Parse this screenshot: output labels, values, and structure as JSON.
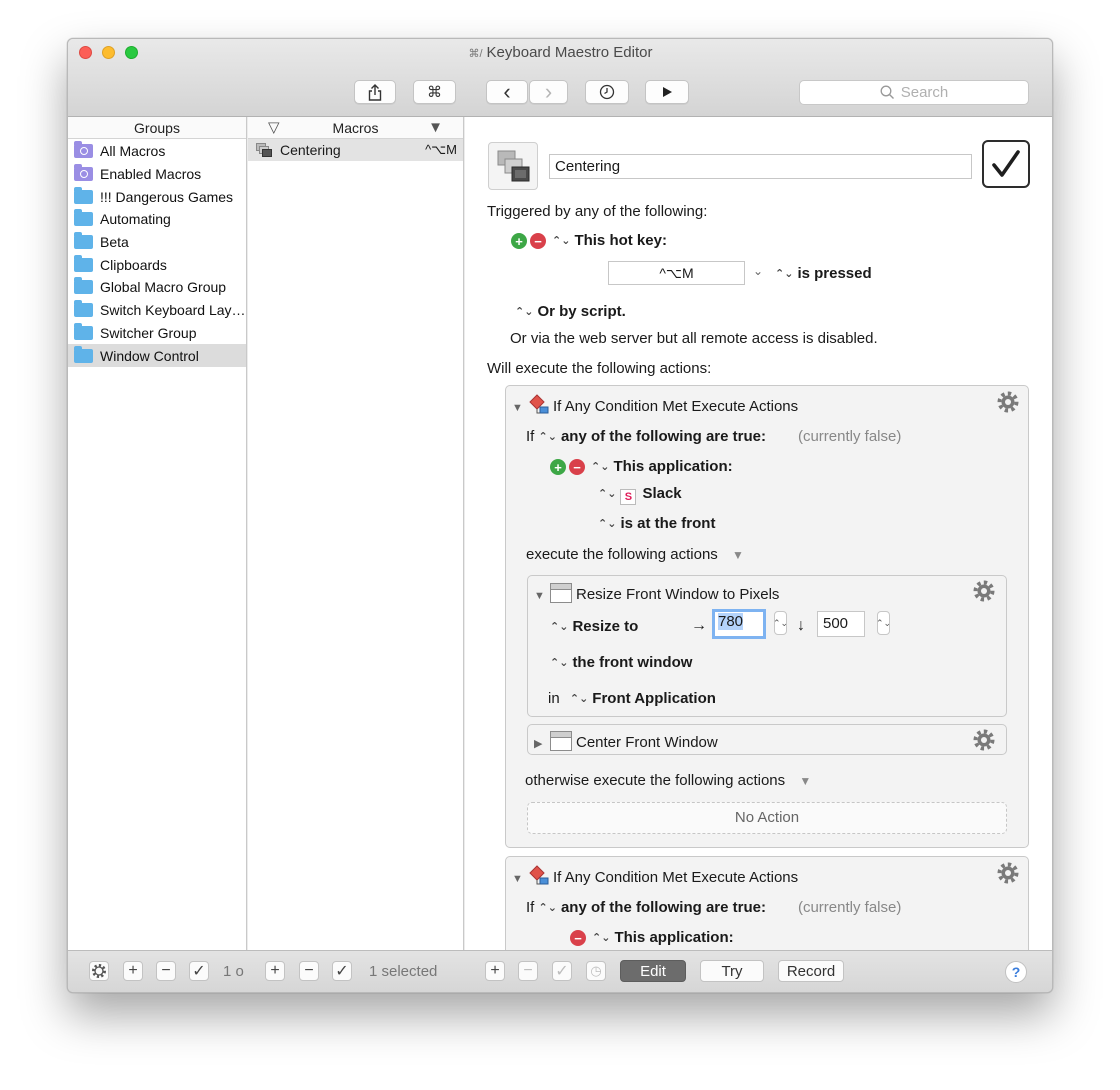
{
  "window": {
    "title": "Keyboard Maestro Editor"
  },
  "toolbar": {
    "share_icon": "share-icon",
    "cmd_label": "⌘",
    "back_label": "‹",
    "forward_label": "›",
    "search_placeholder": "Search"
  },
  "groups": {
    "header": "Groups",
    "items": [
      {
        "label": "All Macros",
        "type": "smart"
      },
      {
        "label": "Enabled Macros",
        "type": "smart"
      },
      {
        "label": "!!! Dangerous Games",
        "type": "folder"
      },
      {
        "label": "Automating",
        "type": "folder"
      },
      {
        "label": "Beta",
        "type": "folder"
      },
      {
        "label": "Clipboards",
        "type": "folder"
      },
      {
        "label": "Global Macro Group",
        "type": "folder"
      },
      {
        "label": "Switch Keyboard Lay…",
        "type": "folder"
      },
      {
        "label": "Switcher Group",
        "type": "folder"
      },
      {
        "label": "Window Control",
        "type": "folder",
        "selected": true
      }
    ]
  },
  "macros": {
    "header": "Macros",
    "items": [
      {
        "label": "Centering",
        "hotkey": "^⌥M"
      }
    ]
  },
  "editor": {
    "macro_name": "Centering",
    "triggered_by": "Triggered by any of the following:",
    "hot_key_label": "This hot key:",
    "hot_key_value": "^⌥M",
    "is_pressed": "is pressed",
    "or_by_script": "Or by script.",
    "web_server": "Or via the web server but all remote access is disabled.",
    "will_execute": "Will execute the following actions:",
    "action1": {
      "title": "If Any Condition Met Execute Actions",
      "if": "If",
      "condition": "any of the following are true:",
      "status": "(currently false)",
      "app_label": "This application:",
      "app_name": "Slack",
      "is_front": "is at the front",
      "execute": "execute the following actions",
      "resize": {
        "title": "Resize Front Window to Pixels",
        "resize_to": "Resize to",
        "width": "780",
        "height": "500",
        "target": "the front window",
        "in_label": "in",
        "app": "Front Application"
      },
      "center": {
        "title": "Center Front Window"
      },
      "otherwise": "otherwise execute the following actions",
      "no_action": "No Action"
    },
    "action2": {
      "title": "If Any Condition Met Execute Actions",
      "if": "If",
      "condition": "any of the following are true:",
      "status": "(currently false)",
      "app_label": "This application:"
    }
  },
  "bottombar": {
    "groups_count": "1 o",
    "macros_selected": "1 selected",
    "edit": "Edit",
    "try": "Try",
    "record": "Record",
    "help": "?"
  },
  "colors": {
    "accent_blue": "#3a7ddc",
    "folder_blue": "#5fb3e9",
    "smart_purple": "#9a8ee4",
    "plus_green": "#3da746",
    "minus_red": "#d9404a"
  }
}
